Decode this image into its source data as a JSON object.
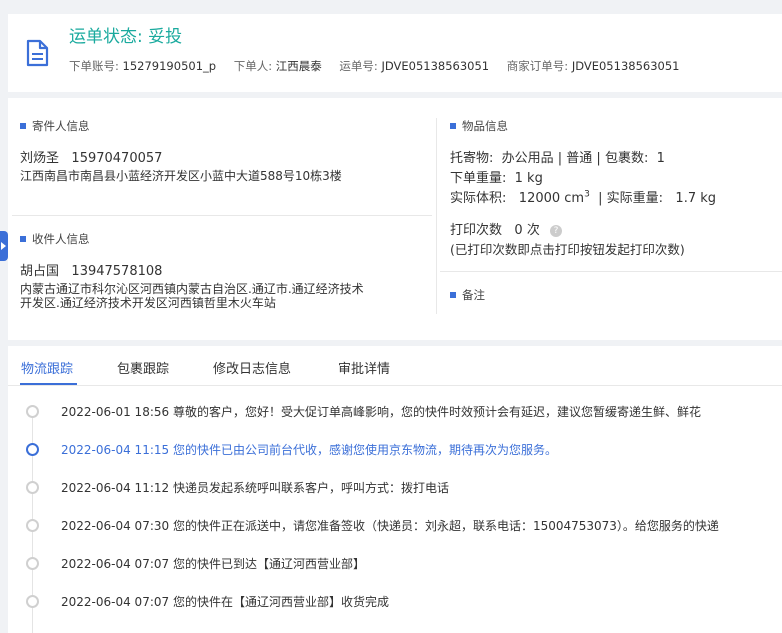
{
  "header": {
    "status_title": "运单状态: 妥投",
    "account_label": "下单账号:",
    "account_value": "15279190501_p",
    "orderer_label": "下单人:",
    "orderer_value": "江西晨泰",
    "waybill_label": "运单号:",
    "waybill_value": "JDVE05138563051",
    "merchant_label": "商家订单号:",
    "merchant_value": "JDVE05138563051"
  },
  "sender": {
    "title": "寄件人信息",
    "name": "刘炀圣",
    "phone": "15970470057",
    "address": "江西南昌市南昌县小蓝经济开发区小蓝中大道588号10栋3楼"
  },
  "receiver": {
    "title": "收件人信息",
    "name": "胡占国",
    "phone": "13947578108",
    "address_line1": "内蒙古通辽市科尔沁区河西镇内蒙古自治区.通辽市.通辽经济技术",
    "address_line2": "开发区.通辽经济技术开发区河西镇哲里木火车站"
  },
  "goods": {
    "title": "物品信息",
    "consign_label": "托寄物:",
    "consign_value": "办公用品 | 普通 | 包裹数:",
    "package_count": "1",
    "weight_label": "下单重量:",
    "weight_value": "1 kg",
    "volume_label": "实际体积:",
    "volume_value": "12000 cm",
    "volume_sup": "3",
    "actual_weight_label": "| 实际重量:",
    "actual_weight_value": "1.7 kg",
    "print_label": "打印次数",
    "print_value": "0 次",
    "print_note": "(已打印次数即点击打印按钮发起打印次数)",
    "help_glyph": "?"
  },
  "remark": {
    "title": "备注"
  },
  "tabs": [
    "物流跟踪",
    "包裹跟踪",
    "修改日志信息",
    "审批详情"
  ],
  "timeline": [
    {
      "text": "2022-06-01 18:56 尊敬的客户，您好！受大促订单高峰影响，您的快件时效预计会有延迟，建议您暂缓寄递生鲜、鲜花",
      "active": false
    },
    {
      "text": "2022-06-04 11:15 您的快件已由公司前台代收，感谢您使用京东物流，期待再次为您服务。",
      "active": true
    },
    {
      "text": "2022-06-04 11:12 快递员发起系统呼叫联系客户，呼叫方式：拨打电话",
      "active": false
    },
    {
      "text": "2022-06-04 07:30 您的快件正在派送中，请您准备签收（快递员：刘永超，联系电话：15004753073）。给您服务的快递",
      "active": false
    },
    {
      "text": "2022-06-04 07:07 您的快件已到达【通辽河西营业部】",
      "active": false
    },
    {
      "text": "2022-06-04 07:07 您的快件在【通辽河西营业部】收货完成",
      "active": false
    }
  ],
  "colors": {
    "accent": "#3b6fd8",
    "status": "#1aaa9e"
  },
  "icons": {
    "header": "document-icon",
    "side": "expand-arrow-icon"
  }
}
